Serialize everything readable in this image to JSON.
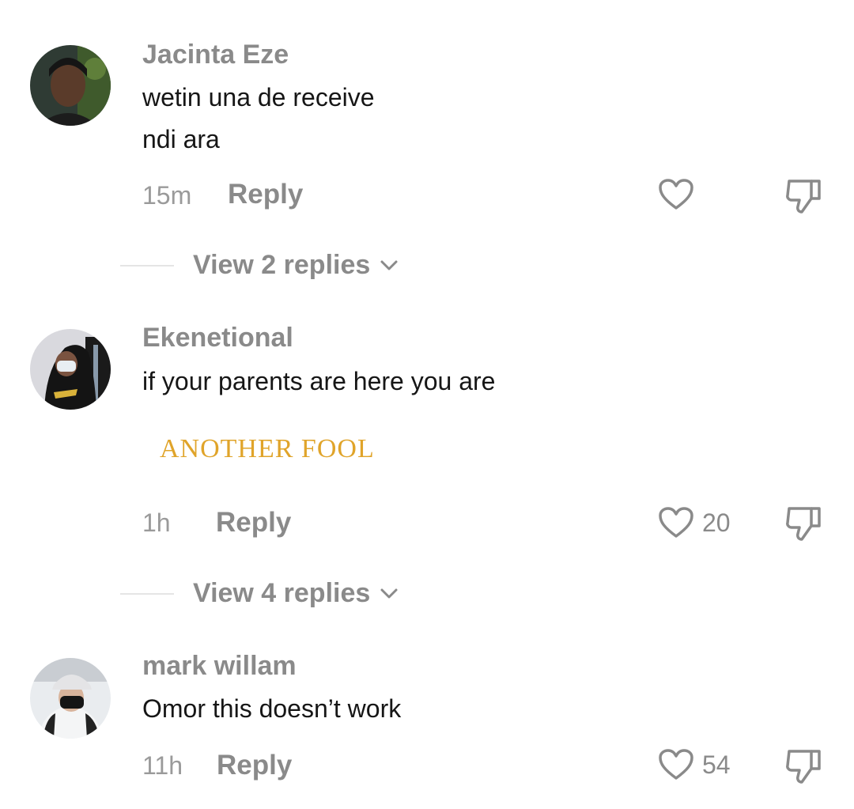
{
  "comments": [
    {
      "username": "Jacinta Eze",
      "lines": [
        "wetin una de receive",
        "ndi ara"
      ],
      "time": "15m",
      "reply_label": "Reply",
      "like_count": "",
      "avatar_icon": "avatar-photo"
    },
    {
      "username": "Ekenetional",
      "lines": [
        "if your parents are here you are"
      ],
      "sticker_text": "ANOTHER FOOL",
      "time": "1h",
      "reply_label": "Reply",
      "like_count": "20",
      "avatar_icon": "avatar-photo"
    },
    {
      "username": "mark willam",
      "lines": [
        "Omor this doesn’t work"
      ],
      "time": "11h",
      "reply_label": "Reply",
      "like_count": "54",
      "avatar_icon": "avatar-photo"
    }
  ],
  "view_replies": [
    "View 2 replies",
    "View 4 replies"
  ],
  "icons": {
    "like": "heart-outline-icon",
    "dislike": "thumbs-down-icon",
    "expand": "chevron-down-icon"
  },
  "colors": {
    "username": "#8a8a8a",
    "text": "#161616",
    "sticker": "#e0a42a"
  }
}
